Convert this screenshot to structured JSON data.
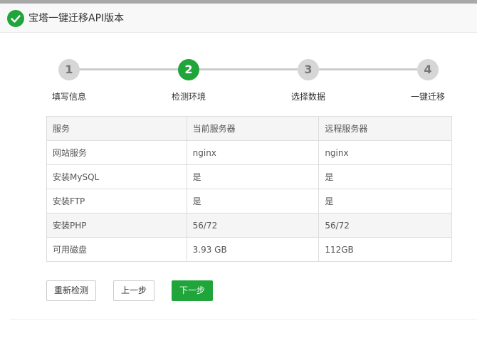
{
  "header": {
    "title": "宝塔一键迁移API版本",
    "icon": "check-circle-icon",
    "accent": "#20a53a"
  },
  "steps": [
    {
      "num": "1",
      "label": "填写信息",
      "active": false
    },
    {
      "num": "2",
      "label": "检测环境",
      "active": true
    },
    {
      "num": "3",
      "label": "选择数据",
      "active": false
    },
    {
      "num": "4",
      "label": "一键迁移",
      "active": false
    }
  ],
  "table": {
    "headers": [
      "服务",
      "当前服务器",
      "远程服务器"
    ],
    "rows": [
      [
        "网站服务",
        "nginx",
        "nginx"
      ],
      [
        "安装MySQL",
        "是",
        "是"
      ],
      [
        "安装FTP",
        "是",
        "是"
      ],
      [
        "安装PHP",
        "56/72",
        "56/72"
      ],
      [
        "可用磁盘",
        "3.93 GB",
        "112GB"
      ]
    ]
  },
  "buttons": {
    "recheck": "重新检测",
    "prev": "上一步",
    "next": "下一步"
  }
}
